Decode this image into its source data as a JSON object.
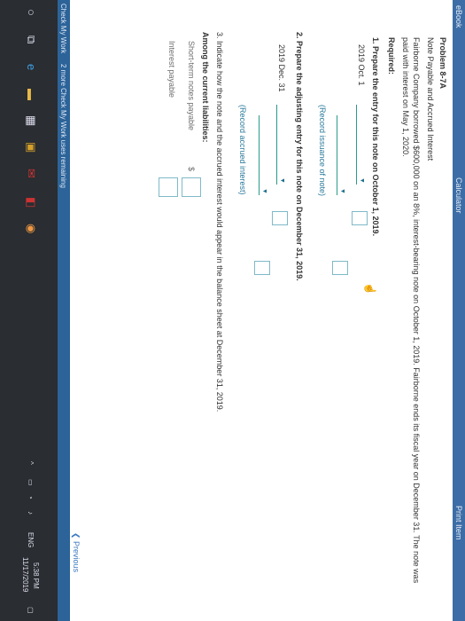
{
  "header": {
    "ebook": "eBook",
    "calculator": "Calculator",
    "print": "Print Item"
  },
  "problem": {
    "title": "Problem 8-7A",
    "subtitle": "Note Payable and Accrued Interest",
    "intro_1": "Fairborne Company borrowed $600,000 on an 8%, interest-bearing note on October 1, 2019. Fairborne ends its fiscal year on December 31. The note was",
    "intro_2": "paid with interest on May 1, 2020.",
    "required": "Required:",
    "q1": "1.  Prepare the entry for this note on October 1, 2019.",
    "q1_date": "2019 Oct. 1",
    "q1_memo": "(Record issuance of note)",
    "q2": "2.  Prepare the adjusting entry for this note on December 31, 2019.",
    "q2_date": "2019 Dec. 31",
    "q2_memo": "(Record accrued interest)",
    "q3": "3.  Indicate how the note and the accrued interest would appear in the balance sheet at December 31, 2019.",
    "q3_heading": "Among the current liabilities:",
    "short_term": "Short-term notes payable",
    "interest_payable": "Interest payable",
    "dollar": "$"
  },
  "footer": {
    "check_my_work": "Check My Work",
    "checks_remaining": "2 more Check My Work uses remaining",
    "previous": "Previous"
  },
  "taskbar": {
    "language": "ENG",
    "time": "5:38 PM",
    "date": "11/17/2019"
  },
  "colors": {
    "accent": "#3d6da6",
    "teal": "#2a7a9c",
    "taskbar": "#2a2d31"
  }
}
